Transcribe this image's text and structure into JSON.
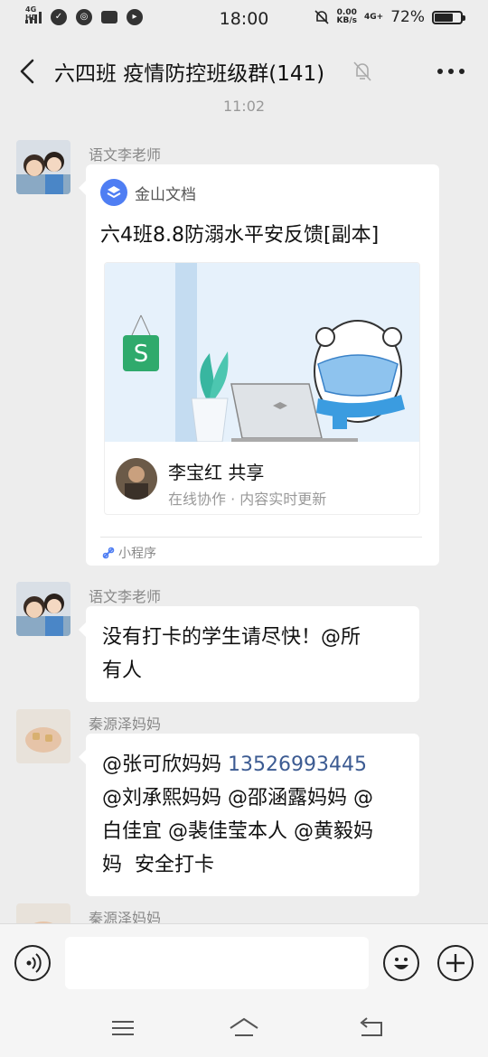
{
  "status_bar": {
    "network_left": "4G HD",
    "time": "18:00",
    "speed_value": "0.00",
    "speed_unit": "KB/s",
    "network_right": "4G+",
    "battery": "72%",
    "battery_level": 0.72
  },
  "header": {
    "title": "六四班 疫情防控班级群(141)"
  },
  "chat": {
    "timestamp": "11:02",
    "messages": [
      {
        "sender": "语文李老师",
        "type": "mini_program",
        "app_name": "金山文档",
        "doc_title": "六4班8.8防溺水平安反馈[副本]",
        "share_user": "李宝红 共享",
        "share_sub": "在线协作 · 内容实时更新",
        "tag": "小程序"
      },
      {
        "sender": "语文李老师",
        "type": "text",
        "text": "没有打卡的学生请尽快！@所\n有人"
      },
      {
        "sender": "秦源泽妈妈",
        "type": "text",
        "text_before": "@张可欣妈妈 ",
        "phone": "13526993445",
        "text_after": "\n@刘承熙妈妈 @邵涵露妈妈 @\n白佳宜 @裴佳莹本人 @黄毅妈\n妈  安全打卡"
      },
      {
        "sender": "秦源泽妈妈",
        "type": "partial"
      }
    ]
  },
  "icons": {
    "back": "chevron-left-icon",
    "mute": "bell-off-icon",
    "more": "more-dots-icon",
    "voice": "voice-icon",
    "emoji": "emoji-icon",
    "plus": "plus-icon"
  }
}
